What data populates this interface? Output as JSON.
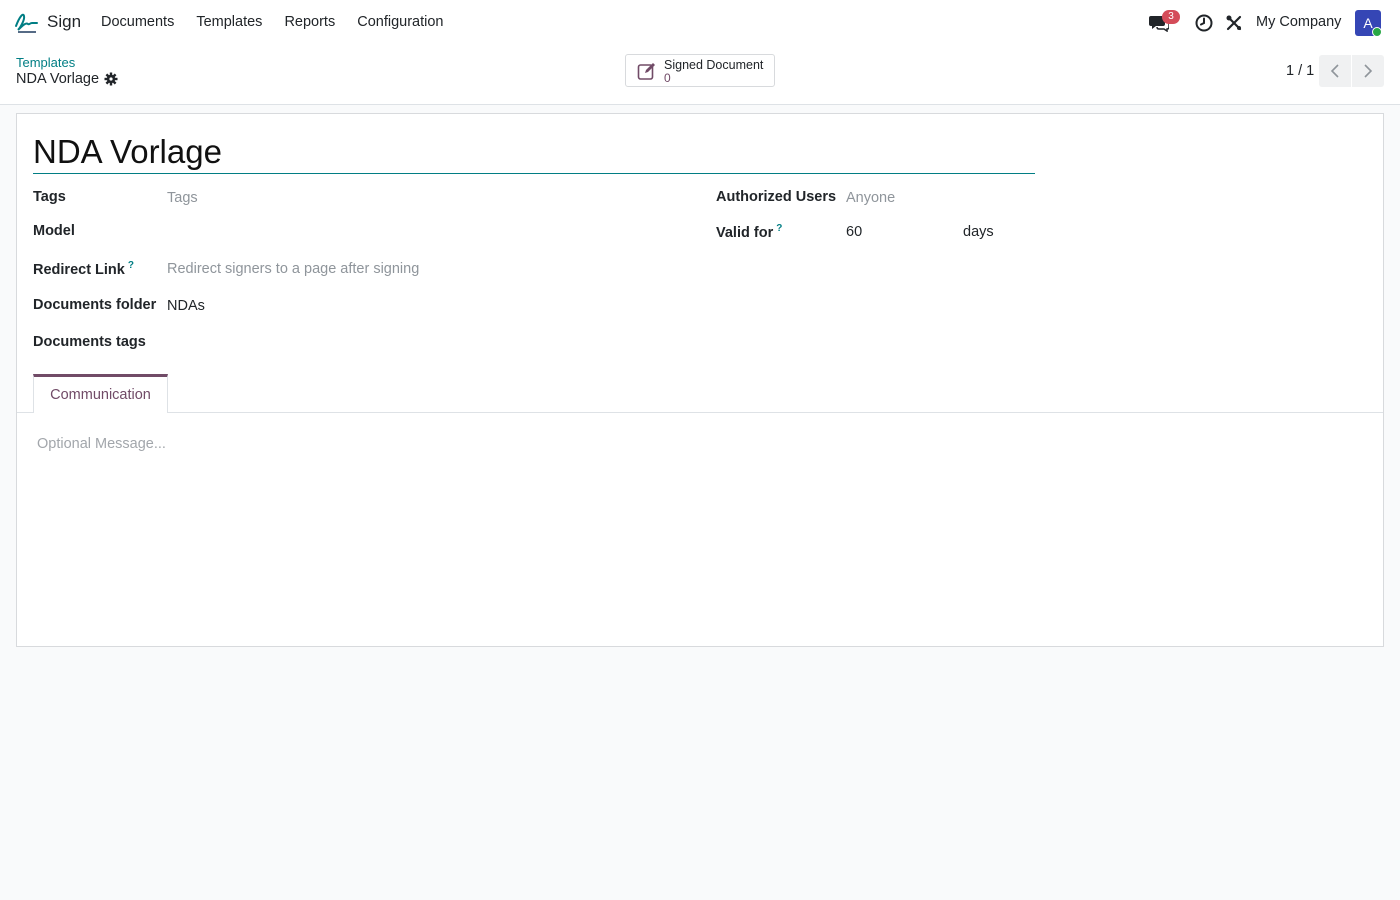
{
  "navbar": {
    "app_name": "Sign",
    "menu": [
      {
        "label": "Documents"
      },
      {
        "label": "Templates"
      },
      {
        "label": "Reports"
      },
      {
        "label": "Configuration"
      }
    ],
    "messages_badge": "3",
    "company": "My Company",
    "avatar_initial": "A",
    "icons": [
      "sign-logo-icon",
      "chat-icon",
      "clock-icon",
      "tools-icon"
    ]
  },
  "control_panel": {
    "breadcrumb_parent": "Templates",
    "breadcrumb_current": "NDA Vorlage",
    "smart_button": {
      "label": "Signed Document",
      "value": "0",
      "icon": "pen-to-square-icon"
    },
    "pager": "1 / 1"
  },
  "form": {
    "title": "NDA Vorlage",
    "tags_label": "Tags",
    "tags_placeholder": "Tags",
    "model_label": "Model",
    "redirect_label": "Redirect Link",
    "redirect_placeholder": "Redirect signers to a page after signing",
    "folder_label": "Documents folder",
    "folder_value": "NDAs",
    "doc_tags_label": "Documents tags",
    "auth_users_label": "Authorized Users",
    "auth_users_placeholder": "Anyone",
    "valid_for_label": "Valid for",
    "valid_for_value": "60",
    "valid_for_unit": "days",
    "help_mark": "?"
  },
  "notebook": {
    "tabs": [
      {
        "label": "Communication"
      }
    ],
    "message_placeholder": "Optional Message..."
  },
  "colors": {
    "accent": "#714b67",
    "link": "#017e84",
    "badge": "#d44c59",
    "avatar": "#3546b5"
  }
}
